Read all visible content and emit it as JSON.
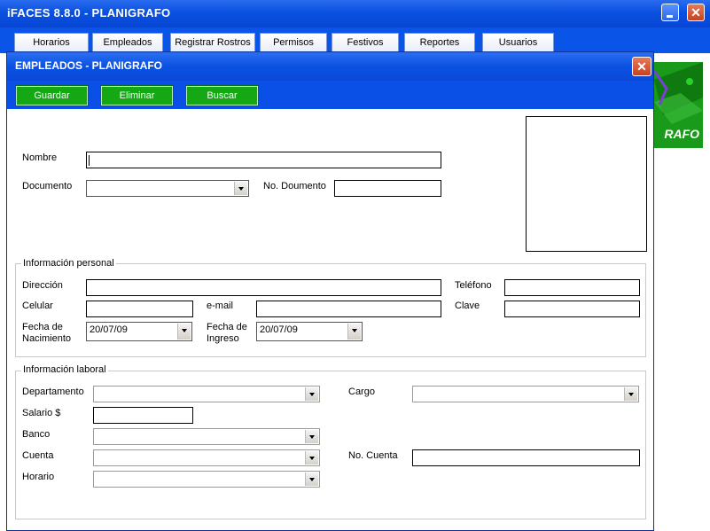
{
  "app": {
    "title": "iFACES  8.8.0 - PLANIGRAFO",
    "minimize": "_",
    "close": "✕"
  },
  "tabs": [
    "Horarios",
    "Empleados",
    "Registrar Rostros",
    "Permisos",
    "Festivos",
    "Reportes",
    "Usuarios"
  ],
  "logo": {
    "text": "RAFO"
  },
  "dialog": {
    "title": "EMPLEADOS - PLANIGRAFO",
    "close": "✕",
    "toolbar": {
      "save": "Guardar",
      "delete": "Eliminar",
      "search": "Buscar"
    },
    "identity": {
      "nombre_label": "Nombre",
      "nombre_value": "",
      "documento_label": "Documento",
      "documento_value": "",
      "no_documento_label": "No. Doumento",
      "no_documento_value": ""
    },
    "personal": {
      "legend": "Información personal",
      "direccion_label": "Dirección",
      "telefono_label": "Teléfono",
      "celular_label": "Celular",
      "email_label": "e-mail",
      "clave_label": "Clave",
      "fecha_nacimiento_label_1": "Fecha de",
      "fecha_nacimiento_label_2": "Nacimiento",
      "fecha_nacimiento_value": "20/07/09",
      "fecha_ingreso_label_1": "Fecha de",
      "fecha_ingreso_label_2": "Ingreso",
      "fecha_ingreso_value": "20/07/09"
    },
    "laboral": {
      "legend": "Información laboral",
      "departamento_label": "Departamento",
      "cargo_label": "Cargo",
      "salario_label": "Salario $",
      "banco_label": "Banco",
      "cuenta_label": "Cuenta",
      "no_cuenta_label": "No. Cuenta",
      "horario_label": "Horario"
    }
  },
  "colors": {
    "titlebar": "#0a50e0",
    "button_green": "#15a815",
    "close_red": "#c6421e"
  }
}
